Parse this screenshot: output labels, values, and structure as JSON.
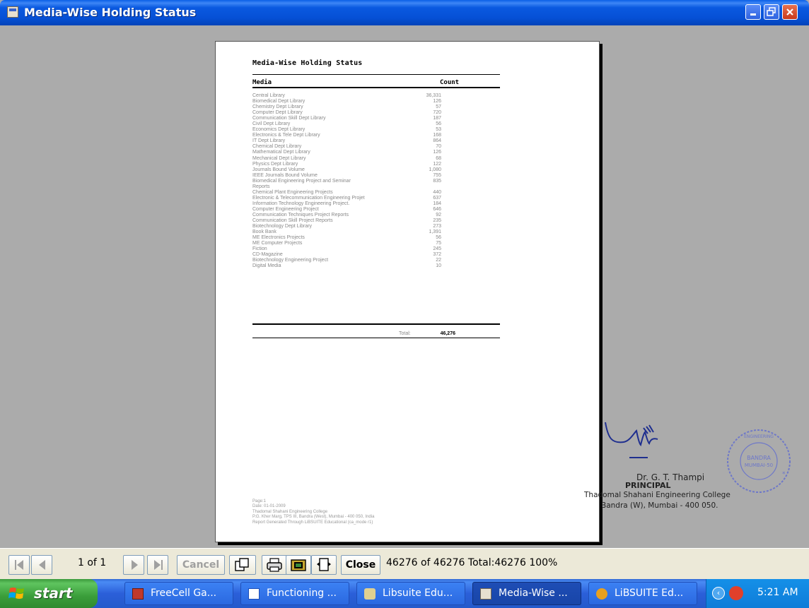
{
  "window": {
    "title": "Media-Wise Holding Status"
  },
  "report": {
    "title": "Media-Wise Holding Status",
    "col_media": "Media",
    "col_count": "Count",
    "rows": [
      {
        "media": "Central Library",
        "count": "36,331"
      },
      {
        "media": "Biomedical Dept Library",
        "count": "126"
      },
      {
        "media": "Chemistry Dept Library",
        "count": "57"
      },
      {
        "media": "Computer Dept Library",
        "count": "720"
      },
      {
        "media": "Communication Skill Dept Library",
        "count": "187"
      },
      {
        "media": "Civil Dept Library",
        "count": "56"
      },
      {
        "media": "Economics Dept Library",
        "count": "53"
      },
      {
        "media": "Electronics & Tele Dept Library",
        "count": "168"
      },
      {
        "media": "IT Dept Library",
        "count": "864"
      },
      {
        "media": "Chemical Dept Library",
        "count": "70"
      },
      {
        "media": "Mathematical Dept Library",
        "count": "126"
      },
      {
        "media": "Mechanical Dept Library",
        "count": "68"
      },
      {
        "media": "Physics Dept Library",
        "count": "122"
      },
      {
        "media": "Journals Bound Volume",
        "count": "1,080"
      },
      {
        "media": "IEEE Journals Bound Volume",
        "count": "755"
      },
      {
        "media": "Biomedical Engineering Project and Seminar",
        "count": "835"
      },
      {
        "media": "Reports",
        "count": ""
      },
      {
        "media": "Chemical Plant Engineering Projects",
        "count": "440"
      },
      {
        "media": "Electronic & Telecommunication Engineering Projet",
        "count": "637"
      },
      {
        "media": "Information Technology Engineering Project.",
        "count": "184"
      },
      {
        "media": "Computer Engineering Project",
        "count": "646"
      },
      {
        "media": "Communication Techniques Project Reports",
        "count": "92"
      },
      {
        "media": "Communication Skill Project Reports",
        "count": "235"
      },
      {
        "media": "Biotechnology Dept Library",
        "count": "273"
      },
      {
        "media": "Book Bank",
        "count": "1,391"
      },
      {
        "media": "ME Electronics Projects",
        "count": "56"
      },
      {
        "media": "ME Computer Projects",
        "count": "75"
      },
      {
        "media": "Fiction",
        "count": "245"
      },
      {
        "media": "CD-Magazine",
        "count": "372"
      },
      {
        "media": "Biotechnology Engineering Project",
        "count": "22"
      },
      {
        "media": "Digital Media",
        "count": "10"
      }
    ],
    "total_label": "Total:",
    "total_value": "46,276",
    "footer": [
      "Page:1",
      "Date: 01-01-2009",
      "Thadomal Shahani Engineering College",
      "P.G. Kher Marg, TPS III, Bandra (West), Mumbai - 400 050, India",
      "Report Generated Through LiBSUITE Educational (ca_mode r1)"
    ]
  },
  "signature": {
    "name": "Dr. G. T. Thampi",
    "title": "PRINCIPAL",
    "college": "Thadomal Shahani Engineering College",
    "address": "Bandra (W), Mumbai - 400 050.",
    "seal_text": "THADOMAL SHAHANI ENGINEERING COLLEGE BANDRA MUMBAI-50"
  },
  "toolbar": {
    "page_info": "1 of 1",
    "cancel_label": "Cancel",
    "close_label": "Close",
    "status": "46276 of 46276  Total:46276  100%"
  },
  "taskbar": {
    "start_label": "start",
    "tasks": [
      "FreeCell Ga...",
      "Functioning ...",
      "Libsuite Edu...",
      "Media-Wise ...",
      "LiBSUITE Ed..."
    ],
    "clock": "5:21 AM"
  },
  "colors": {
    "titlebar": "#0A59E0",
    "workspace": "#ABABAB",
    "toolbar": "#ECE9D8",
    "start": "#3A9D3A",
    "taskbar": "#245ACB"
  }
}
